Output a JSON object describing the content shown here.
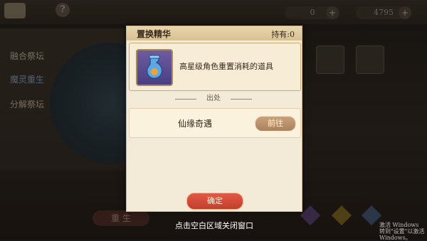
{
  "hud": {
    "resource1_value": "0",
    "resource2_value": "4795",
    "help_label": "?"
  },
  "sidebar": {
    "items": [
      {
        "label": "融合祭坛"
      },
      {
        "label": "魔灵重生"
      },
      {
        "label": "分解祭坛"
      }
    ]
  },
  "scene": {
    "rebirth_label": "重 生"
  },
  "dialog": {
    "title": "置换精华",
    "owned": "持有:0",
    "item_desc": "高星级角色重置消耗的道具",
    "source_header": "出处",
    "source_name": "仙缘奇遇",
    "go_label": "前往",
    "confirm_label": "确定"
  },
  "close_hint": "点击空白区域关闭窗口",
  "windows_watermark": {
    "line1": "激活 Windows",
    "line2": "转到\"设置\"以激活 Windows。"
  },
  "colors": {
    "accent_red": "#d84a36",
    "panel_bg": "#f3ead8",
    "go_button": "#b88e68"
  }
}
